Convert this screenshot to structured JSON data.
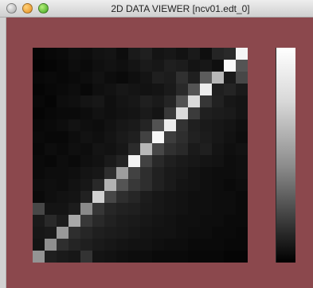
{
  "window": {
    "title": "2D DATA VIEWER [ncv01.edt_0]"
  },
  "heatmap": {
    "rows": 18,
    "cols": 18,
    "values": [
      [
        0.02,
        0.03,
        0.04,
        0.06,
        0.05,
        0.07,
        0.08,
        0.05,
        0.1,
        0.12,
        0.08,
        0.09,
        0.07,
        0.1,
        0.06,
        0.14,
        0.16,
        0.96
      ],
      [
        0.01,
        0.02,
        0.03,
        0.05,
        0.04,
        0.06,
        0.07,
        0.06,
        0.08,
        0.1,
        0.09,
        0.12,
        0.11,
        0.08,
        0.09,
        0.06,
        0.98,
        0.33
      ],
      [
        0.03,
        0.04,
        0.03,
        0.04,
        0.05,
        0.07,
        0.05,
        0.04,
        0.06,
        0.08,
        0.12,
        0.11,
        0.19,
        0.12,
        0.36,
        0.72,
        0.1,
        0.28
      ],
      [
        0.02,
        0.03,
        0.04,
        0.05,
        0.03,
        0.06,
        0.07,
        0.09,
        0.08,
        0.07,
        0.08,
        0.1,
        0.16,
        0.33,
        0.93,
        0.12,
        0.14,
        0.1
      ],
      [
        0.03,
        0.02,
        0.05,
        0.06,
        0.08,
        0.09,
        0.06,
        0.08,
        0.09,
        0.12,
        0.1,
        0.14,
        0.32,
        0.86,
        0.21,
        0.13,
        0.09,
        0.08
      ],
      [
        0.02,
        0.03,
        0.04,
        0.04,
        0.05,
        0.07,
        0.06,
        0.07,
        0.08,
        0.1,
        0.08,
        0.22,
        0.86,
        0.23,
        0.12,
        0.11,
        0.1,
        0.08
      ],
      [
        0.03,
        0.04,
        0.05,
        0.07,
        0.06,
        0.05,
        0.07,
        0.09,
        0.1,
        0.14,
        0.32,
        0.93,
        0.2,
        0.12,
        0.1,
        0.09,
        0.08,
        0.06
      ],
      [
        0.04,
        0.03,
        0.03,
        0.05,
        0.07,
        0.06,
        0.08,
        0.1,
        0.12,
        0.26,
        0.97,
        0.24,
        0.18,
        0.13,
        0.11,
        0.09,
        0.07,
        0.05
      ],
      [
        0.03,
        0.05,
        0.04,
        0.06,
        0.05,
        0.08,
        0.07,
        0.09,
        0.17,
        0.72,
        0.28,
        0.19,
        0.16,
        0.1,
        0.12,
        0.08,
        0.06,
        0.07
      ],
      [
        0.04,
        0.03,
        0.05,
        0.04,
        0.06,
        0.07,
        0.1,
        0.14,
        0.95,
        0.26,
        0.16,
        0.12,
        0.1,
        0.09,
        0.08,
        0.07,
        0.05,
        0.06
      ],
      [
        0.04,
        0.05,
        0.05,
        0.06,
        0.08,
        0.09,
        0.18,
        0.62,
        0.26,
        0.18,
        0.13,
        0.1,
        0.09,
        0.07,
        0.06,
        0.05,
        0.05,
        0.06
      ],
      [
        0.05,
        0.06,
        0.05,
        0.07,
        0.09,
        0.16,
        0.7,
        0.33,
        0.22,
        0.18,
        0.13,
        0.1,
        0.08,
        0.07,
        0.06,
        0.05,
        0.04,
        0.05
      ],
      [
        0.04,
        0.06,
        0.07,
        0.08,
        0.13,
        0.82,
        0.28,
        0.18,
        0.15,
        0.11,
        0.09,
        0.08,
        0.07,
        0.06,
        0.06,
        0.05,
        0.05,
        0.04
      ],
      [
        0.28,
        0.08,
        0.08,
        0.11,
        0.54,
        0.21,
        0.15,
        0.13,
        0.12,
        0.1,
        0.09,
        0.08,
        0.07,
        0.06,
        0.06,
        0.05,
        0.05,
        0.04
      ],
      [
        0.1,
        0.16,
        0.11,
        0.66,
        0.22,
        0.16,
        0.13,
        0.11,
        0.1,
        0.09,
        0.08,
        0.07,
        0.06,
        0.06,
        0.05,
        0.05,
        0.04,
        0.04
      ],
      [
        0.09,
        0.1,
        0.6,
        0.18,
        0.15,
        0.12,
        0.11,
        0.1,
        0.09,
        0.08,
        0.07,
        0.07,
        0.06,
        0.05,
        0.05,
        0.04,
        0.04,
        0.03
      ],
      [
        0.08,
        0.56,
        0.18,
        0.14,
        0.12,
        0.1,
        0.09,
        0.08,
        0.07,
        0.07,
        0.06,
        0.05,
        0.05,
        0.04,
        0.04,
        0.04,
        0.03,
        0.03
      ],
      [
        0.58,
        0.12,
        0.1,
        0.09,
        0.2,
        0.08,
        0.07,
        0.06,
        0.05,
        0.05,
        0.04,
        0.04,
        0.04,
        0.03,
        0.03,
        0.03,
        0.02,
        0.02
      ]
    ]
  }
}
